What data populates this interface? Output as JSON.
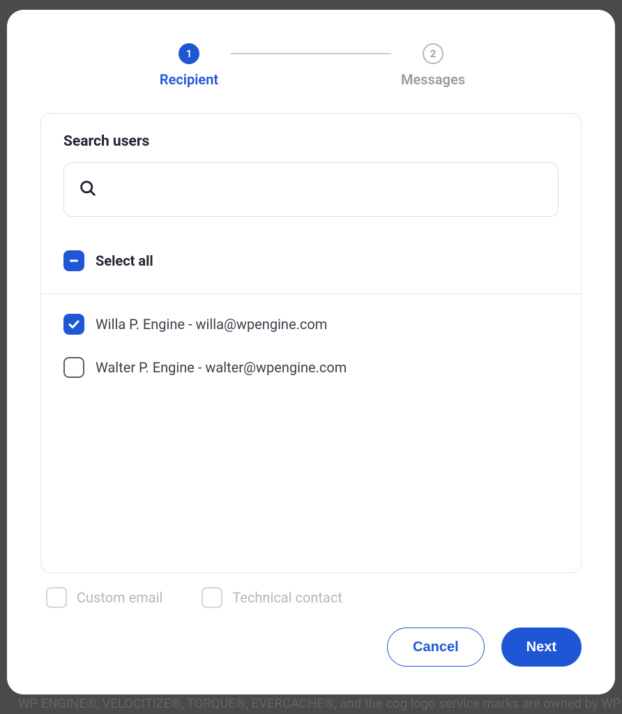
{
  "stepper": {
    "step1": {
      "num": "1",
      "label": "Recipient"
    },
    "step2": {
      "num": "2",
      "label": "Messages"
    }
  },
  "search": {
    "title": "Search users",
    "placeholder": ""
  },
  "selectAll": {
    "label": "Select all"
  },
  "users": [
    {
      "label": "Willa P. Engine - willa@wpengine.com",
      "checked": true
    },
    {
      "label": "Walter P. Engine - walter@wpengine.com",
      "checked": false
    }
  ],
  "options": {
    "customEmail": "Custom email",
    "technicalContact": "Technical contact"
  },
  "footer": {
    "cancel": "Cancel",
    "next": "Next"
  },
  "background": {
    "text": "WP ENGINE®, VELOCITIZE®, TORQUE®, EVERCACHE®, and the cog logo service marks are owned by WPEn"
  }
}
